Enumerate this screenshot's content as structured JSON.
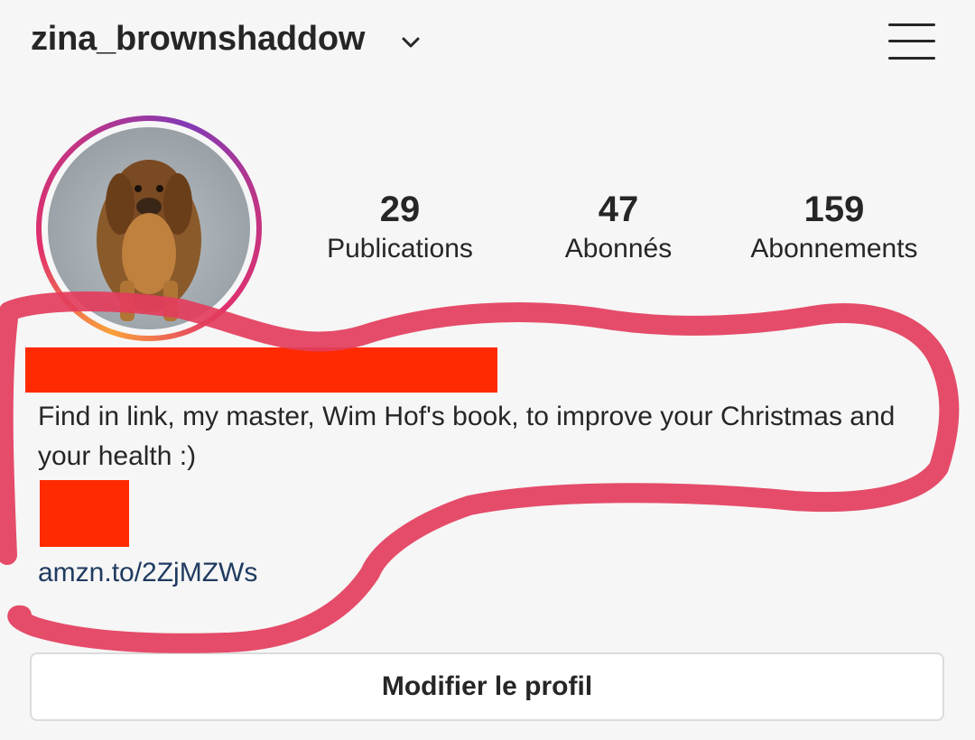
{
  "header": {
    "username": "zina_brownshaddow",
    "dropdown_icon": "chevron-down-icon",
    "menu_icon": "hamburger-menu-icon"
  },
  "profile": {
    "avatar_description_icon": "avatar-photo",
    "stats": [
      {
        "value": "29",
        "label": "Publications"
      },
      {
        "value": "47",
        "label": "Abonnés"
      },
      {
        "value": "159",
        "label": "Abonnements"
      }
    ]
  },
  "bio": {
    "text": "Find in link, my master, Wim Hof's book, to improve your Christmas and your health :)",
    "link": "amzn.to/2ZjMZWs"
  },
  "actions": {
    "edit_profile": "Modifier le profil"
  },
  "colors": {
    "redaction": "#ff2a00",
    "scribble": "#e33d5c",
    "link": "#1f3b60"
  }
}
